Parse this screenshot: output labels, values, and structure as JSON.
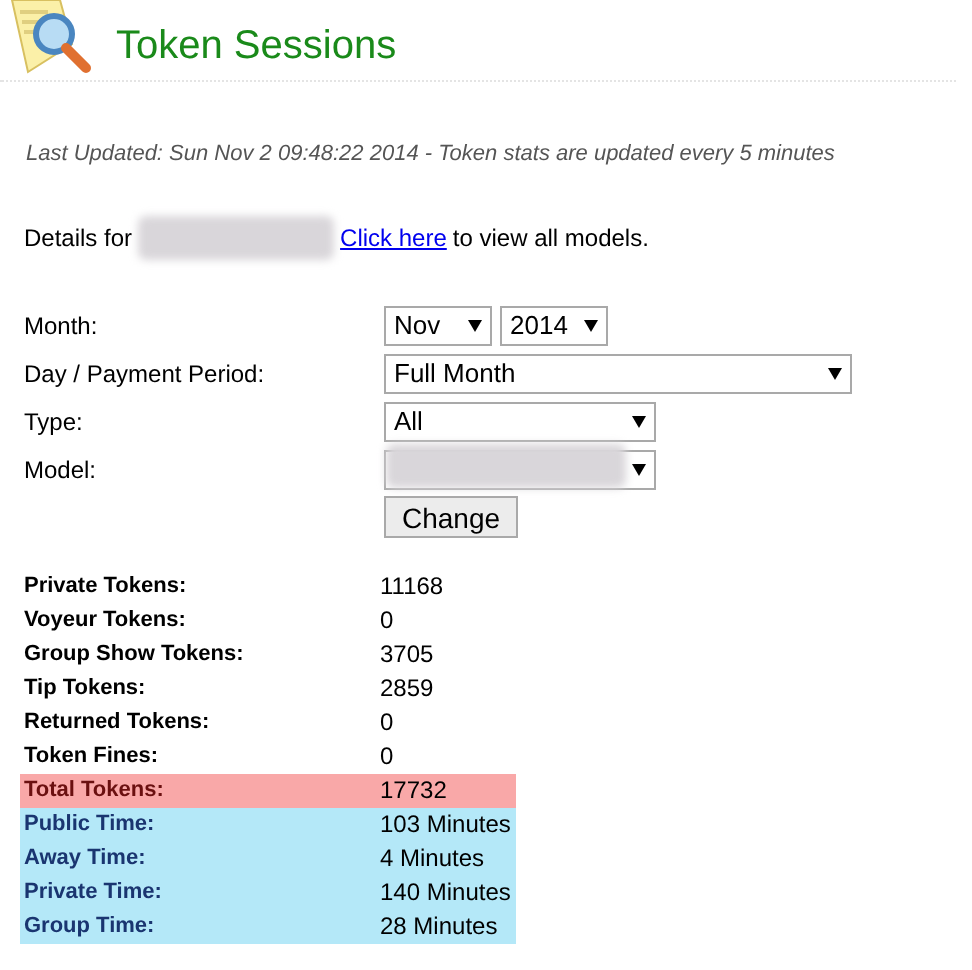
{
  "title": "Token Sessions",
  "last_updated": "Last Updated: Sun Nov 2 09:48:22 2014 - Token stats are updated every 5 minutes",
  "details": {
    "prefix": "Details for",
    "link": "Click here",
    "suffix": "to view all models."
  },
  "form": [
    {
      "label": "Month:",
      "selects": [
        {
          "value": "Nov"
        },
        {
          "value": "2014"
        }
      ]
    },
    {
      "label": "Day / Payment Period:",
      "selects": [
        {
          "value": "Full Month"
        }
      ]
    },
    {
      "label": "Type:",
      "selects": [
        {
          "value": "All"
        }
      ]
    },
    {
      "label": "Model:",
      "selects": [
        {
          "blurred": true
        }
      ]
    }
  ],
  "button": "Change",
  "stats": [
    {
      "label": "Private Tokens:",
      "value": "11168",
      "kind": "plain"
    },
    {
      "label": "Voyeur Tokens:",
      "value": "0",
      "kind": "plain"
    },
    {
      "label": "Group Show Tokens:",
      "value": "3705",
      "kind": "plain"
    },
    {
      "label": "Tip Tokens:",
      "value": "2859",
      "kind": "plain"
    },
    {
      "label": "Returned Tokens:",
      "value": "0",
      "kind": "plain"
    },
    {
      "label": "Token Fines:",
      "value": "0",
      "kind": "plain"
    },
    {
      "label": "Total Tokens:",
      "value": "17732",
      "kind": "total"
    },
    {
      "label": "Public Time:",
      "value": "103 Minutes",
      "kind": "time"
    },
    {
      "label": "Away Time:",
      "value": "4 Minutes",
      "kind": "time"
    },
    {
      "label": "Private Time:",
      "value": "140 Minutes",
      "kind": "time"
    },
    {
      "label": "Group Time:",
      "value": "28 Minutes",
      "kind": "time"
    }
  ]
}
